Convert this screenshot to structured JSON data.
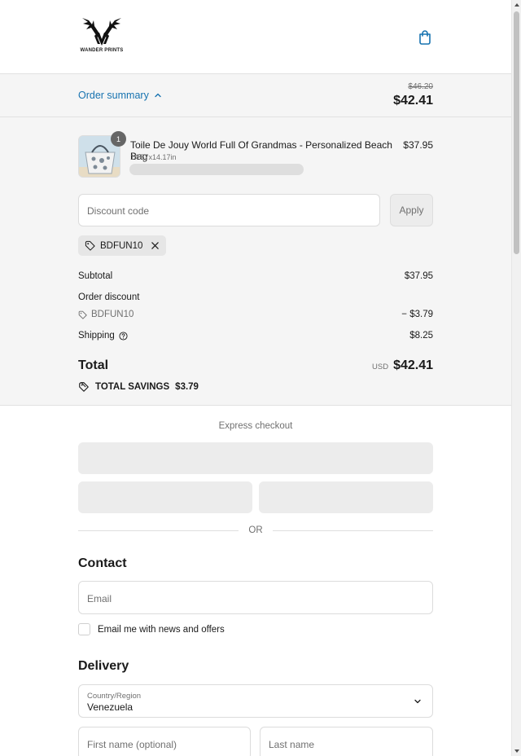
{
  "brand": {
    "logo_text": "WANDER PRINTS"
  },
  "summary": {
    "toggle_label": "Order summary",
    "compare_at_price": "$46.20",
    "total_price": "$42.41"
  },
  "product": {
    "quantity": "1",
    "title": "Toile De Jouy World Full Of Grandmas - Personalized Beach Bag",
    "variant": "14.57x14.17in",
    "price": "$37.95"
  },
  "discount": {
    "placeholder": "Discount code",
    "apply_label": "Apply",
    "applied_code": "BDFUN10"
  },
  "totals": {
    "subtotal_label": "Subtotal",
    "subtotal_value": "$37.95",
    "order_discount_label": "Order discount",
    "discount_code": "BDFUN10",
    "discount_value": "− $3.79",
    "shipping_label": "Shipping",
    "shipping_value": "$8.25",
    "total_label": "Total",
    "currency": "USD",
    "total_value": "$42.41",
    "savings_label": "TOTAL SAVINGS",
    "savings_value": "$3.79"
  },
  "express": {
    "label": "Express checkout",
    "or_label": "OR"
  },
  "contact": {
    "heading": "Contact",
    "email_placeholder": "Email",
    "newsletter_label": "Email me with news and offers"
  },
  "delivery": {
    "heading": "Delivery",
    "country_label": "Country/Region",
    "country_value": "Venezuela",
    "first_name_placeholder": "First name (optional)",
    "last_name_placeholder": "Last name"
  },
  "colors": {
    "link": "#1773b0",
    "summary_bg": "#f5f5f5"
  },
  "icons": [
    "shopping-bag-icon",
    "chevron-up-icon",
    "tag-icon",
    "close-icon",
    "help-circle-icon",
    "savings-tag-icon",
    "chevron-down-icon"
  ]
}
